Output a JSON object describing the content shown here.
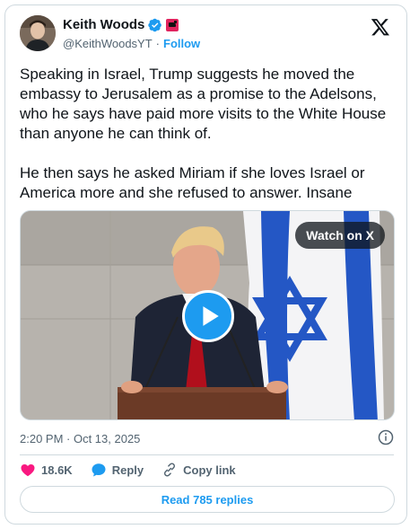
{
  "author": {
    "name": "Keith Woods",
    "handle": "@KeithWoodsYT",
    "separator": "·",
    "follow_label": "Follow"
  },
  "icons": {
    "verified": "verified-badge-icon",
    "affiliation": "affiliation-badge-icon",
    "brand": "x-logo-icon",
    "info": "info-icon",
    "like": "heart-icon",
    "reply": "reply-bubble-icon",
    "copy": "link-icon",
    "play": "play-icon"
  },
  "colors": {
    "accent": "#1d9bf0",
    "like": "#f91880",
    "text": "#0f1419",
    "muted": "#536471",
    "border": "#cfd9de"
  },
  "tweet": {
    "text": "Speaking in Israel, Trump suggests he moved the embassy to Jerusalem as a promise to the Adelsons, who he says have paid more visits to the White House than anyone he can think of.\n\nHe then says he asked Miriam if she loves Israel or America more and she refused to answer. Insane"
  },
  "media": {
    "watch_label": "Watch on X"
  },
  "meta": {
    "timestamp": "2:20 PM · Oct 13, 2025"
  },
  "actions": {
    "likes": "18.6K",
    "reply_label": "Reply",
    "copy_label": "Copy link"
  },
  "read_replies": "Read 785 replies"
}
